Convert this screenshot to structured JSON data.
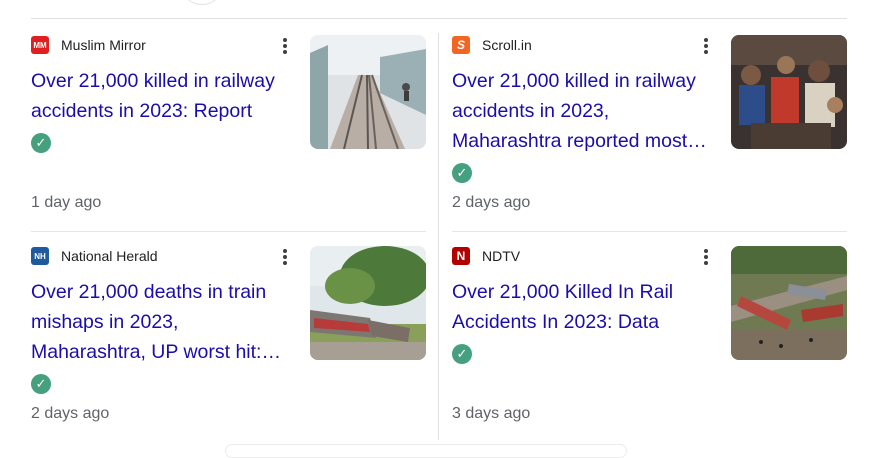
{
  "articles": [
    {
      "source": "Muslim Mirror",
      "favicon_text": "MM",
      "favicon_color": "#e02020",
      "headline_lines": [
        "Over 21,000 killed in railway",
        "accidents in 2023: Report"
      ],
      "time": "1 day ago",
      "thumbnail_icon": "railway-track-image",
      "verified": true
    },
    {
      "source": "Scroll.in",
      "favicon_text": "S",
      "favicon_color": "#f26522",
      "headline_lines": [
        "Over 21,000 killed in railway",
        "accidents in 2023,",
        "Maharashtra reported most…"
      ],
      "time": "2 days ago",
      "thumbnail_icon": "crowd-image",
      "verified": true
    },
    {
      "source": "National Herald",
      "favicon_text": "NH",
      "favicon_color": "#1f5a9e",
      "headline_lines": [
        "Over 21,000 deaths in train",
        "mishaps in 2023,",
        "Maharashtra, UP worst hit:…"
      ],
      "time": "2 days ago",
      "thumbnail_icon": "derailed-train-image",
      "verified": true
    },
    {
      "source": "NDTV",
      "favicon_text": "N",
      "favicon_color": "#b20000",
      "headline_lines": [
        "Over 21,000 Killed In Rail",
        "Accidents In 2023: Data"
      ],
      "time": "3 days ago",
      "thumbnail_icon": "train-wreck-aerial-image",
      "verified": true
    }
  ],
  "colors": {
    "headline": "#1a0dab",
    "verified_badge": "#45a07f",
    "meta_text": "#5f6368",
    "divider": "#e0e0e0"
  }
}
